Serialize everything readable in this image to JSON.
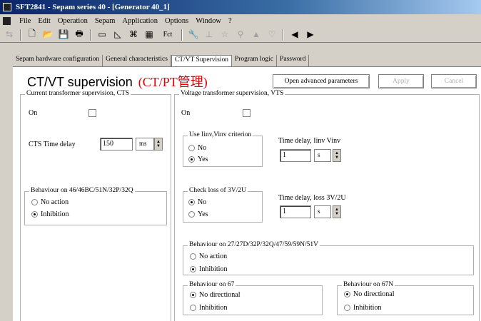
{
  "window": {
    "title": "SFT2841 - Sepam series 40 - [Generator 40_1]"
  },
  "menu": [
    "File",
    "Edit",
    "Operation",
    "Sepam",
    "Application",
    "Options",
    "Window",
    "?"
  ],
  "toolbar": {
    "fct_label": "Fct"
  },
  "tabs": [
    {
      "label": "Sepam hardware configuration"
    },
    {
      "label": "General characteristics"
    },
    {
      "label": "CT/VT Supervision"
    },
    {
      "label": "Program logic"
    },
    {
      "label": "Password"
    }
  ],
  "page": {
    "title": "CT/VT supervision",
    "title_cn": "(CT/PT管理)"
  },
  "buttons": {
    "advanced": "Open advanced parameters",
    "apply": "Apply",
    "cancel": "Cancel"
  },
  "cts": {
    "legend": "Current transformer supervision, CTS",
    "on_label": "On",
    "time_delay_label": "CTS Time delay",
    "time_delay_value": "150",
    "time_delay_unit": "ms",
    "behaviour_legend": "Behaviour on 46/46BC/51N/32P/32Q",
    "no_action": "No action",
    "inhibition": "Inhibition"
  },
  "vts": {
    "legend": "Voltage transformer supervision, VTS",
    "on_label": "On",
    "criterion_legend": "Use Iinv,Vinv criterion",
    "no": "No",
    "yes": "Yes",
    "delay_iinv_label": "Time delay, Iinv Vinv",
    "delay_iinv_value": "1",
    "delay_iinv_unit": "s",
    "loss_legend": "Check loss of 3V/2U",
    "loss_no": "No",
    "loss_yes": "Yes",
    "delay_loss_label": "Time delay, loss 3V/2U",
    "delay_loss_value": "1",
    "delay_loss_unit": "s",
    "behaviour_legend": "Behaviour on 27/27D/32P/32Q/47/59/59N/51V",
    "no_action": "No action",
    "inhibition": "Inhibition",
    "b67_legend": "Behaviour on 67",
    "b67_nodir": "No directional",
    "b67_inhib": "Inhibition",
    "b67n_legend": "Behaviour on 67N",
    "b67n_nodir": "No directional",
    "b67n_inhib": "Inhibition"
  }
}
